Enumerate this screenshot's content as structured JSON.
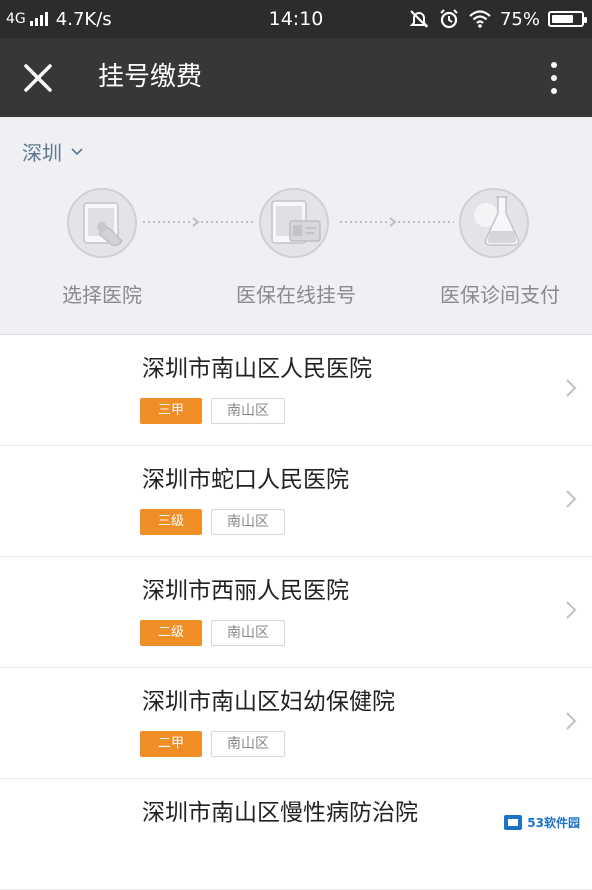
{
  "status_bar": {
    "network": "4G",
    "speed": "4.7K/s",
    "time": "14:10",
    "battery": "75%",
    "battery_level": 0.75
  },
  "header": {
    "title": "挂号缴费",
    "close_icon": "close-icon",
    "more_icon": "more-vertical-icon"
  },
  "city": {
    "selected": "深圳",
    "icon": "chevron-down-icon"
  },
  "steps": [
    {
      "label": "选择医院",
      "icon": "tap-screen-icon"
    },
    {
      "label": "医保在线挂号",
      "icon": "insurance-card-icon"
    },
    {
      "label": "医保诊间支付",
      "icon": "flask-icon"
    }
  ],
  "hospitals": [
    {
      "name": "深圳市南山区人民医院",
      "grade": "三甲",
      "district": "南山区"
    },
    {
      "name": "深圳市蛇口人民医院",
      "grade": "三级",
      "district": "南山区"
    },
    {
      "name": "深圳市西丽人民医院",
      "grade": "二级",
      "district": "南山区"
    },
    {
      "name": "深圳市南山区妇幼保健院",
      "grade": "二甲",
      "district": "南山区"
    },
    {
      "name": "深圳市南山区慢性病防治院",
      "grade": "",
      "district": ""
    }
  ],
  "watermark": {
    "text": "53软件园"
  },
  "colors": {
    "status_bar_bg": "#2c2c2c",
    "header_bg": "#373737",
    "panel_bg": "#f0eff4",
    "grade_tag": "#f08e26",
    "city_text": "#5b7a8f"
  }
}
